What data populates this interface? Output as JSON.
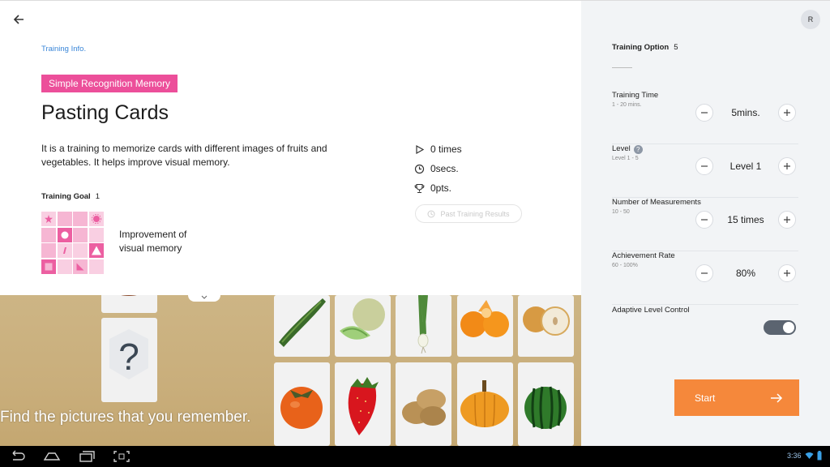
{
  "info": {
    "section_label": "Training Info.",
    "category": "Simple Recognition Memory",
    "title": "Pasting Cards",
    "description": "It is a training to memorize cards with different images of fruits and vegetables. It helps improve visual memory.",
    "goal_label": "Training Goal",
    "goal_count": "1",
    "goal_text_line1": "Improvement of",
    "goal_text_line2": "visual memory"
  },
  "stats": {
    "times": "0 times",
    "seconds": "0secs.",
    "points": "0pts.",
    "past_results_label": "Past Training Results"
  },
  "game": {
    "instruction": "Find the pictures that you remember."
  },
  "settings": {
    "avatar_initial": "R",
    "option_label": "Training Option",
    "option_count": "5",
    "items": [
      {
        "label": "Training Time",
        "range": "1 - 20 mins.",
        "value": "5mins."
      },
      {
        "label": "Level",
        "range": "Level 1 - 5",
        "value": "Level 1"
      },
      {
        "label": "Number of Measurements",
        "range": "10 - 50",
        "value": "15 times"
      },
      {
        "label": "Achievement Rate",
        "range": "60 - 100%",
        "value": "80%"
      }
    ],
    "adaptive_label": "Adaptive Level Control",
    "adaptive_enabled": true,
    "start_label": "Start"
  },
  "system": {
    "time": "3:36"
  },
  "colors": {
    "accent_pink": "#ec4f9a",
    "start_orange": "#f5883b",
    "link_blue": "#3a86d8"
  }
}
